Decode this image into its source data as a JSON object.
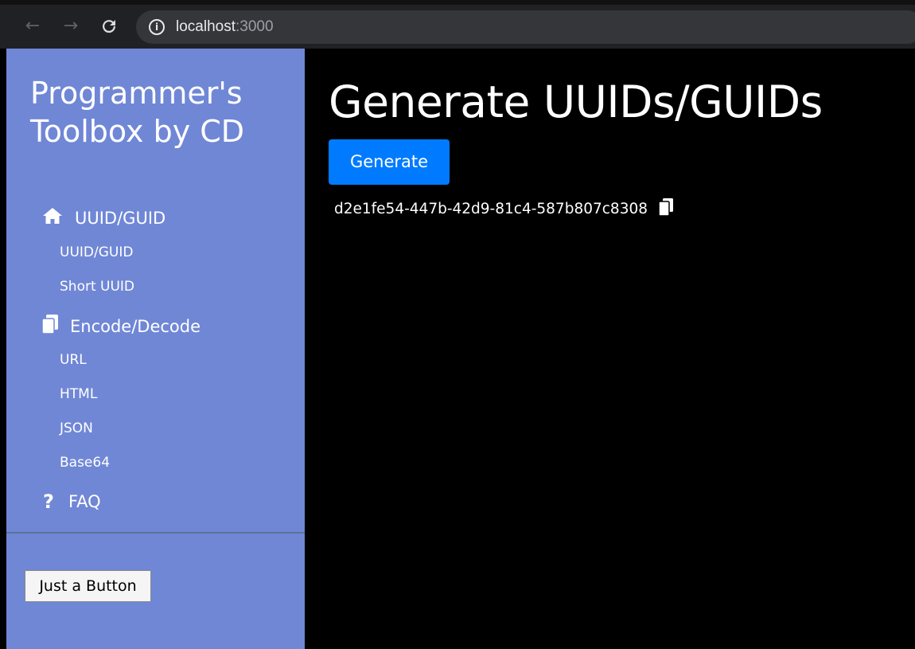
{
  "browser": {
    "url_host": "localhost",
    "url_port": ":3000",
    "back_icon": "arrow-left-icon",
    "forward_icon": "arrow-right-icon",
    "reload_icon": "reload-icon",
    "info_icon": "info-icon"
  },
  "sidebar": {
    "brand": "Programmer's Toolbox by CD",
    "groups": [
      {
        "icon": "home-icon",
        "label": "UUID/GUID",
        "items": [
          "UUID/GUID",
          "Short UUID"
        ]
      },
      {
        "icon": "copy-icon",
        "label": "Encode/Decode",
        "items": [
          "URL",
          "HTML",
          "JSON",
          "Base64"
        ]
      },
      {
        "icon": "question-icon",
        "label": "FAQ",
        "items": []
      }
    ],
    "button_label": "Just a Button",
    "bg_color": "#7087d6"
  },
  "main": {
    "title": "Generate UUIDs/GUIDs",
    "generate_label": "Generate",
    "generate_color": "#007bff",
    "uuid_value": "d2e1fe54-447b-42d9-81c4-587b807c8308",
    "copy_icon": "copy-icon"
  }
}
